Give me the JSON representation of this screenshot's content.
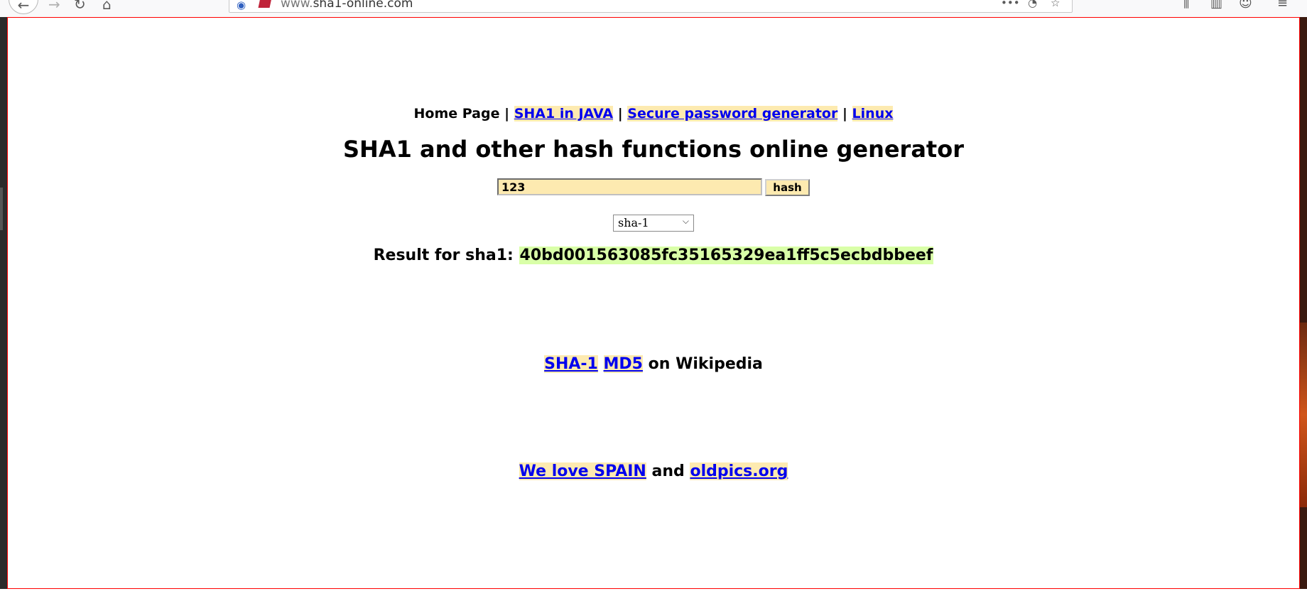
{
  "browser": {
    "url_prefix": "www.",
    "url_main": "sha1-online.com"
  },
  "nav": {
    "home": "Home Page",
    "sep": "|",
    "sha1_java": "SHA1 in JAVA",
    "password_gen": "Secure password generator",
    "linux": "Linux"
  },
  "title": "SHA1 and other hash functions online generator",
  "form": {
    "input_value": "123",
    "button_label": "hash",
    "selected_algorithm": "sha-1"
  },
  "result": {
    "label": "Result for sha1:",
    "value": "40bd001563085fc35165329ea1ff5c5ecbdbbeef"
  },
  "wiki": {
    "sha1_link": "SHA-1",
    "md5_link": "MD5",
    "suffix": "on Wikipedia"
  },
  "footer": {
    "spain_link": "We love SPAIN",
    "and": "and",
    "oldpics_link": "oldpics.org"
  }
}
